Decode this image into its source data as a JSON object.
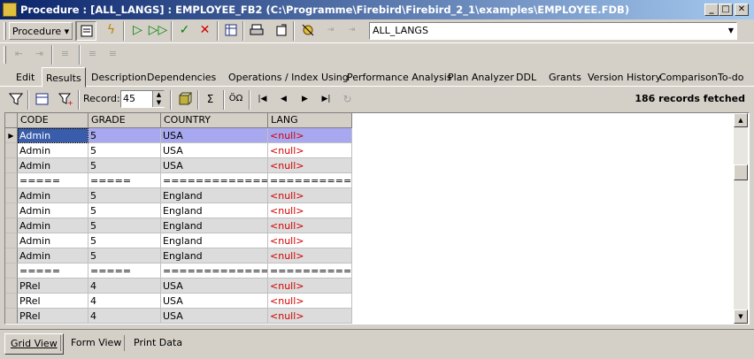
{
  "window": {
    "title": "Procedure : [ALL_LANGS] : EMPLOYEE_FB2 (C:\\Programme\\Firebird\\Firebird_2_1\\examples\\EMPLOYEE.FDB)",
    "minimize": "_",
    "maximize": "□",
    "close": "✕"
  },
  "toolbar": {
    "procedure_menu": "Procedure ▾",
    "procedure_name": "ALL_LANGS"
  },
  "tabs": [
    "Edit",
    "Results",
    "Description",
    "Dependencies",
    "Operations / Index Using",
    "Performance Analysis",
    "Plan Analyzer",
    "DDL",
    "Grants",
    "Version History",
    "Comparison",
    "To-do"
  ],
  "active_tab": "Results",
  "results_toolbar": {
    "record_label": "Record:",
    "record_value": "45",
    "status": "186 records fetched"
  },
  "grid": {
    "columns": [
      "CODE",
      "GRADE",
      "COUNTRY",
      "LANG"
    ],
    "rows": [
      [
        "Admin",
        "5",
        "USA",
        "<null>"
      ],
      [
        "Admin",
        "5",
        "USA",
        "<null>"
      ],
      [
        "Admin",
        "5",
        "USA",
        "<null>"
      ],
      [
        "=====",
        "=====",
        "===============",
        "=============="
      ],
      [
        "Admin",
        "5",
        "England",
        "<null>"
      ],
      [
        "Admin",
        "5",
        "England",
        "<null>"
      ],
      [
        "Admin",
        "5",
        "England",
        "<null>"
      ],
      [
        "Admin",
        "5",
        "England",
        "<null>"
      ],
      [
        "Admin",
        "5",
        "England",
        "<null>"
      ],
      [
        "=====",
        "=====",
        "===============",
        "=============="
      ],
      [
        "PRel",
        "4",
        "USA",
        "<null>"
      ],
      [
        "PRel",
        "4",
        "USA",
        "<null>"
      ],
      [
        "PRel",
        "4",
        "USA",
        "<null>"
      ]
    ],
    "selected_row": 0
  },
  "bottom_tabs": [
    "Grid View",
    "Form View",
    "Print Data"
  ],
  "active_bottom_tab": "Grid View"
}
